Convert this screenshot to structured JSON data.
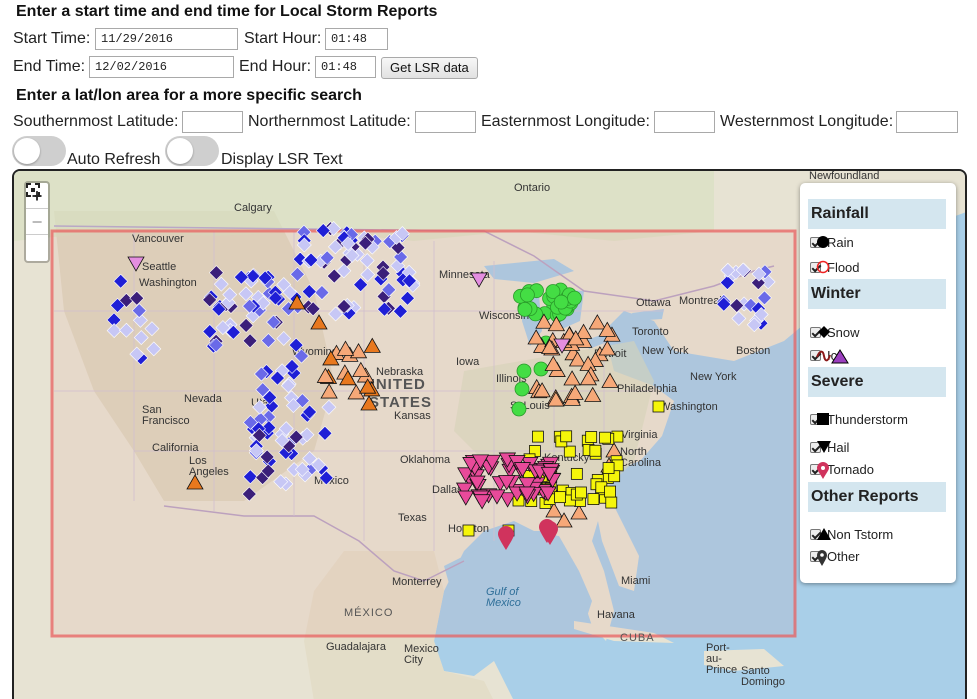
{
  "form": {
    "heading_time": "Enter a start time and end time for Local Storm Reports",
    "start_time_label": "Start Time:",
    "start_time_value": "11/29/2016",
    "start_hour_label": "Start Hour:",
    "start_hour_value": "01:48",
    "end_time_label": "End Time:",
    "end_time_value": "12/02/2016",
    "end_hour_label": "End Hour:",
    "end_hour_value": "01:48",
    "get_button": "Get LSR data",
    "heading_area": "Enter a lat/lon area for a more specific search",
    "south_label": "Southernmost Latitude:",
    "north_label": "Northernmost Latitude:",
    "east_label": "Easternmost Longitude:",
    "west_label": "Westernmost Longitude:",
    "auto_refresh_label": "Auto Refresh",
    "display_text_label": "Display LSR Text"
  },
  "map": {
    "zoom_in": "+",
    "zoom_out": "−",
    "fullscreen_icon": "fullscreen-icon",
    "labels": {
      "ontario": "Ontario",
      "newfoundland": "Newfoundland",
      "calgary": "Calgary",
      "vancouver": "Vancouver",
      "seattle": "Seattle",
      "washington_state": "Washington",
      "minnesota": "Minnesota",
      "ottawa": "Ottawa",
      "montreal": "Montreal",
      "toronto": "Toronto",
      "wisconsin": "Wisconsin",
      "new_york_state": "New York",
      "detroit": "Detroit",
      "boston": "Boston",
      "iowa": "Iowa",
      "nebraska": "Nebraska",
      "united": "UNITED",
      "states": "STATES",
      "wyoming": "Wyoming",
      "nevada": "Nevada",
      "utah": "Utah",
      "kansas": "Kansas",
      "illinois": "Illinois",
      "st_louis": "St Louis",
      "philadelphia": "Philadelphia",
      "new_york_city": "New York",
      "washington_dc": "Washington",
      "san_francisco": "San\nFrancisco",
      "california": "California",
      "virginia": "Virginia",
      "los_angeles": "Los\nAngeles",
      "oklahoma": "Oklahoma",
      "north_carolina": "North\nCarolina",
      "new_mexico": "Mexico",
      "dallas": "Dallas",
      "texas": "Texas",
      "houston": "Houston",
      "kentucky": "Kentucky",
      "monterrey": "Monterrey",
      "gulf": "Gulf of\nMexico",
      "miami": "Miami",
      "mexico_country": "MÉXICO",
      "havana": "Havana",
      "cuba": "CUBA",
      "guadalajara": "Guadalajara",
      "mexico_city": "Mexico\nCity",
      "port_au_prince": "Port-\nau-\nPrince",
      "santo_domingo": "Santo\nDomingo"
    }
  },
  "legend": {
    "rainfall": {
      "title": "Rainfall",
      "items": [
        "Rain",
        "Flood"
      ]
    },
    "winter": {
      "title": "Winter",
      "items": [
        "Snow",
        "Ice"
      ]
    },
    "severe": {
      "title": "Severe",
      "items": [
        "Thunderstorm",
        "Hail",
        "Tornado"
      ]
    },
    "other": {
      "title": "Other Reports",
      "items": [
        "Non Tstorm",
        "Other"
      ]
    }
  },
  "colors": {
    "snow_light": "#c7c7f5",
    "snow_mid": "#6a6ae8",
    "snow_dark": "#1f1fd6",
    "snow_heavy": "#3b1f7a",
    "rain": "#44dd44",
    "non_tstorm": "#f6a878",
    "non_tstorm_dark": "#e8781e",
    "thunderstorm": "#f5f50a",
    "hail": "#e84a9a",
    "tornado": "#d0335d",
    "area_box": "#e86060",
    "water": "#a9cfe8",
    "land": "#e9e5d8"
  }
}
